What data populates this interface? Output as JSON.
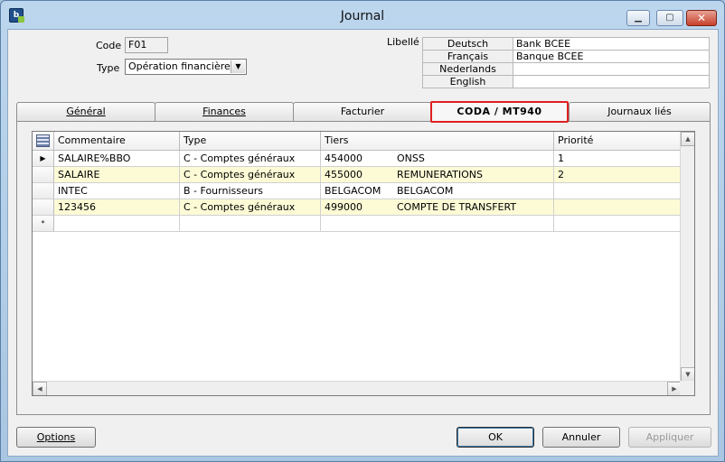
{
  "window": {
    "title": "Journal"
  },
  "header": {
    "code_label": "Code",
    "code_value": "F01",
    "type_label": "Type",
    "type_value": "Opération financière",
    "libelle_label": "Libellé",
    "languages": [
      {
        "lang": "Deutsch",
        "value": "Bank BCEE"
      },
      {
        "lang": "Français",
        "value": "Banque BCEE"
      },
      {
        "lang": "Nederlands",
        "value": ""
      },
      {
        "lang": "English",
        "value": ""
      }
    ]
  },
  "tabs": [
    {
      "label": "Général",
      "active": false
    },
    {
      "label": "Finances",
      "active": false
    },
    {
      "label": "Facturier",
      "active": false
    },
    {
      "label": "CODA / MT940",
      "active": true
    },
    {
      "label": "Journaux liés",
      "active": false
    }
  ],
  "grid": {
    "columns": [
      "Commentaire",
      "Type",
      "Tiers",
      "Priorité"
    ],
    "rows": [
      {
        "indicator": "▶",
        "commentaire": "SALAIRE%BBO",
        "type": "C - Comptes généraux",
        "tiers_code": "454000",
        "tiers_name": "ONSS",
        "priorite": "1"
      },
      {
        "indicator": "",
        "commentaire": "SALAIRE",
        "type": "C - Comptes généraux",
        "tiers_code": "455000",
        "tiers_name": "REMUNERATIONS",
        "priorite": "2"
      },
      {
        "indicator": "",
        "commentaire": "INTEC",
        "type": "B - Fournisseurs",
        "tiers_code": "BELGACOM",
        "tiers_name": "BELGACOM",
        "priorite": ""
      },
      {
        "indicator": "",
        "commentaire": "123456",
        "type": "C - Comptes généraux",
        "tiers_code": "499000",
        "tiers_name": "COMPTE DE TRANSFERT",
        "priorite": ""
      },
      {
        "indicator": "*",
        "commentaire": "",
        "type": "",
        "tiers_code": "",
        "tiers_name": "",
        "priorite": ""
      }
    ]
  },
  "footer": {
    "options_label": "Options",
    "ok_label": "OK",
    "annuler_label": "Annuler",
    "appliquer_label": "Appliquer"
  },
  "colors": {
    "title_bar": "#b8d3ee",
    "alt_row": "#fdfbd6",
    "active_tab_highlight": "#e02020"
  }
}
